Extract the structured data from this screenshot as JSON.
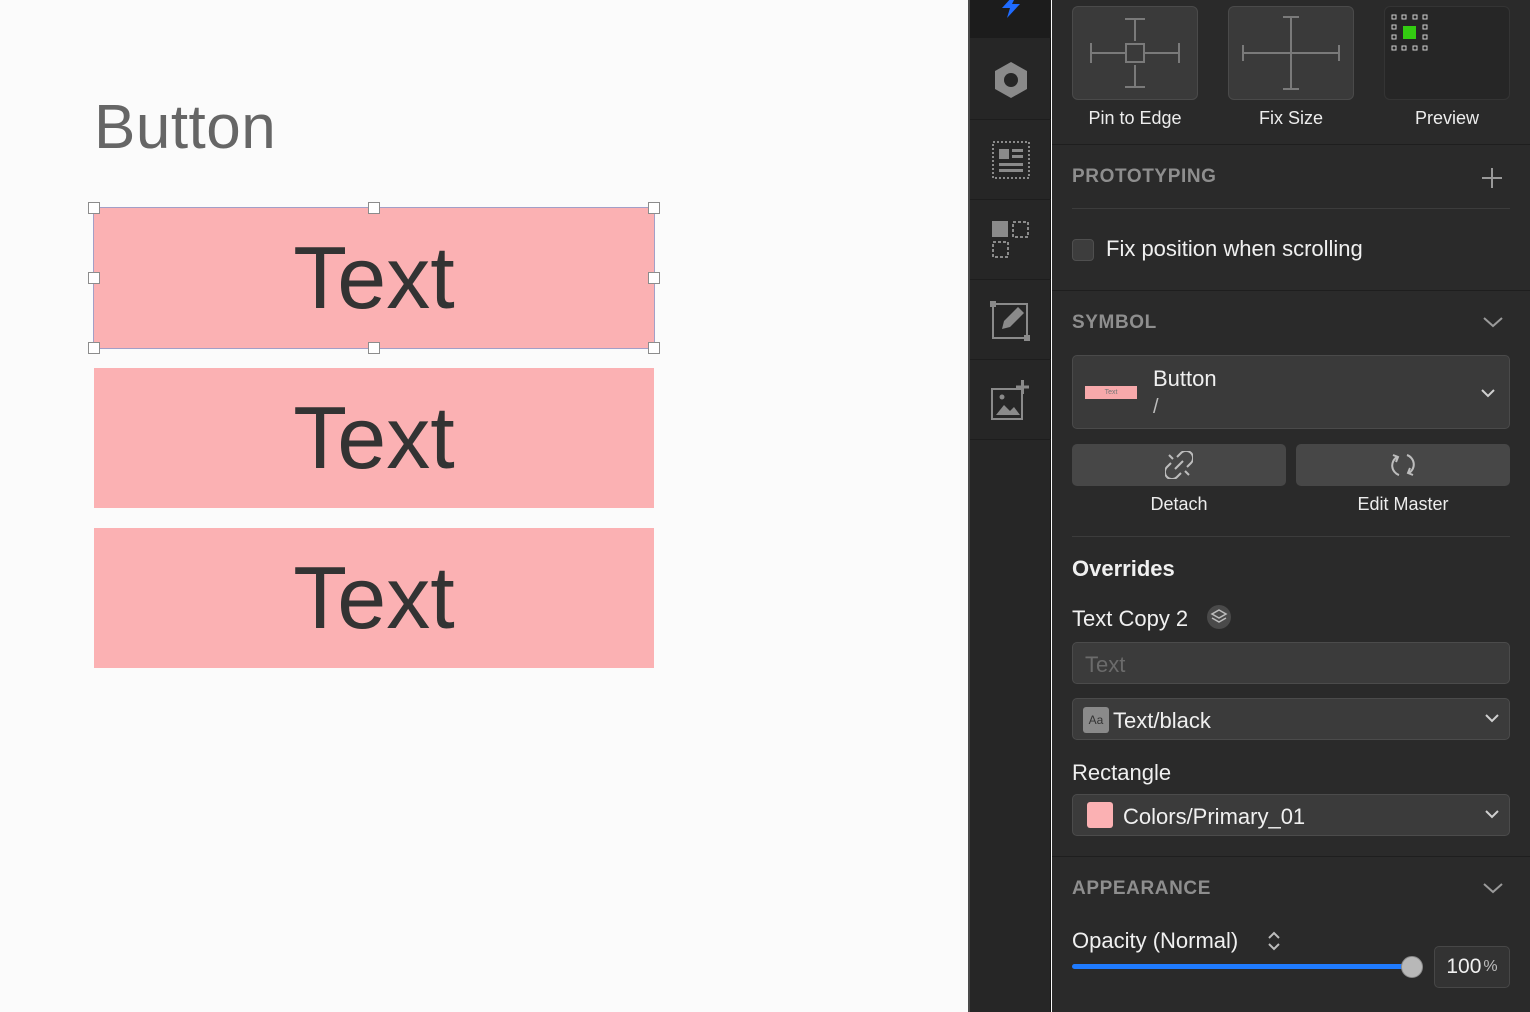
{
  "canvas": {
    "artboard_title": "Button",
    "instances": [
      {
        "label": "Text",
        "selected": true
      },
      {
        "label": "Text",
        "selected": false
      },
      {
        "label": "Text",
        "selected": false
      }
    ],
    "fill_color": "#fbb1b3"
  },
  "toolbar": {
    "tools": [
      "bolt-icon",
      "hexagon-icon",
      "layout-icon",
      "selection-icon",
      "draw-icon",
      "add-image-icon"
    ]
  },
  "inspector": {
    "resizing": {
      "tiles": [
        {
          "label": "Pin to Edge",
          "icon": "pin-to-edge-icon"
        },
        {
          "label": "Fix Size",
          "icon": "fix-size-icon"
        },
        {
          "label": "Preview",
          "icon": "preview-icon"
        }
      ]
    },
    "prototyping": {
      "title": "PROTOTYPING",
      "fix_position_label": "Fix position when scrolling",
      "fix_position_checked": false
    },
    "symbol": {
      "title": "SYMBOL",
      "name": "Button",
      "path": "/",
      "thumb_text": "Text",
      "detach_label": "Detach",
      "edit_master_label": "Edit Master"
    },
    "overrides": {
      "title": "Overrides",
      "text_layer": "Text Copy 2",
      "text_placeholder": "Text",
      "text_style": "Text/black",
      "text_style_icon": "Aa",
      "rect_layer": "Rectangle",
      "rect_color_name": "Colors/Primary_01",
      "rect_color": "#fbb1b3"
    },
    "appearance": {
      "title": "APPEARANCE",
      "opacity_label": "Opacity (Normal)",
      "opacity_value": "100",
      "opacity_unit": "%",
      "opacity_fraction": 1.0
    },
    "accent_color": "#1f7bff"
  }
}
